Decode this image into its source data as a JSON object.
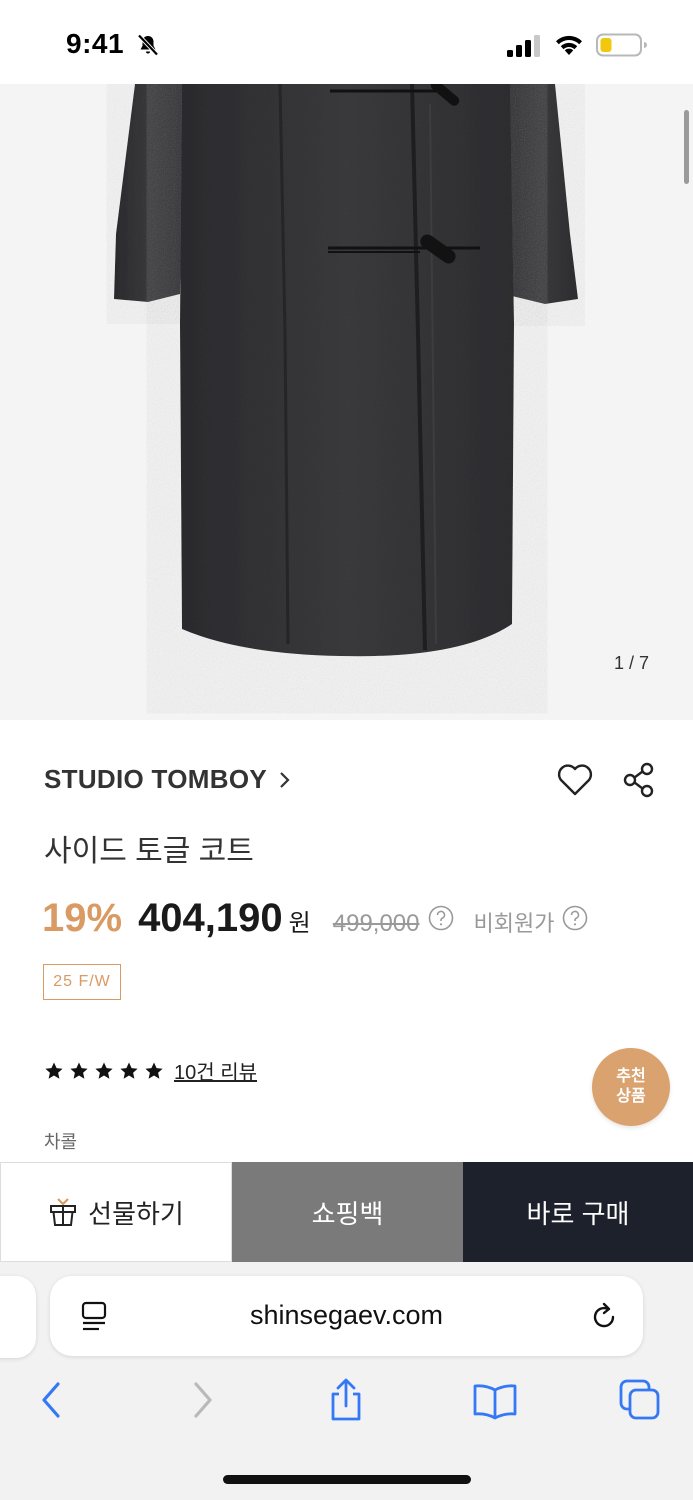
{
  "status_bar": {
    "time": "9:41",
    "icons": [
      "bell-slash-icon",
      "cellular-signal-icon",
      "wifi-icon",
      "battery-low-icon"
    ],
    "battery_color": "#f2c80f"
  },
  "gallery": {
    "counter": "1 / 7"
  },
  "product": {
    "brand": "STUDIO TOMBOY",
    "title": "사이드 토글 코트",
    "discount": "19%",
    "price": "404,190",
    "price_unit": "원",
    "original_price": "499,000",
    "member_price_label": "비회원가",
    "season_badge": "25 F/W",
    "review_link": "10건 리뷰",
    "rating_stars": 5,
    "color_label": "차콜",
    "recommend": {
      "line1": "추천",
      "line2": "상품"
    }
  },
  "actions": {
    "gift_label": "선물하기",
    "bag_label": "쇼핑백",
    "buy_label": "바로 구매"
  },
  "browser": {
    "url": "shinsegaev.com"
  },
  "colors": {
    "accent": "#d99a63",
    "buy_button": "#1d212b",
    "bag_button": "#7a7a7a",
    "safari_blue": "#3478f6"
  }
}
